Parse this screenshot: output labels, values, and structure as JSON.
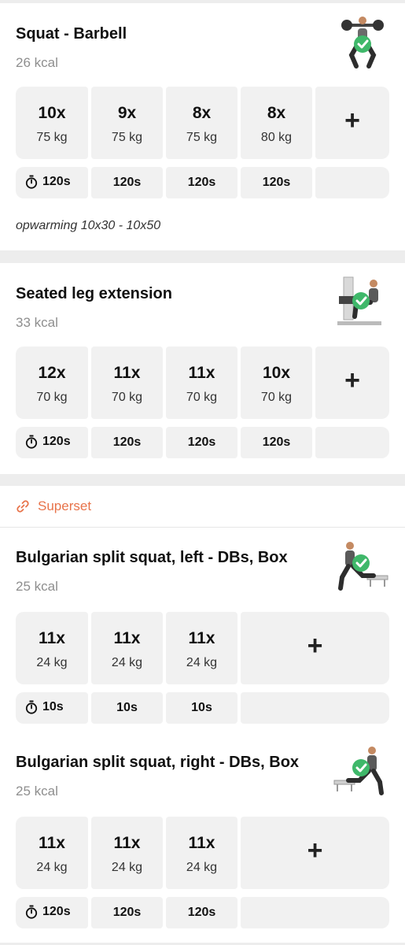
{
  "exercises": [
    {
      "name": "Squat - Barbell",
      "kcal": "26 kcal",
      "sets": [
        {
          "reps": "10x",
          "weight": "75 kg",
          "rest": "120s"
        },
        {
          "reps": "9x",
          "weight": "75 kg",
          "rest": "120s"
        },
        {
          "reps": "8x",
          "weight": "75 kg",
          "rest": "120s"
        },
        {
          "reps": "8x",
          "weight": "80 kg",
          "rest": "120s"
        }
      ],
      "add_label": "+",
      "note": "opwarming 10x30 - 10x50",
      "completed": true
    },
    {
      "name": "Seated leg extension",
      "kcal": "33 kcal",
      "sets": [
        {
          "reps": "12x",
          "weight": "70 kg",
          "rest": "120s"
        },
        {
          "reps": "11x",
          "weight": "70 kg",
          "rest": "120s"
        },
        {
          "reps": "11x",
          "weight": "70 kg",
          "rest": "120s"
        },
        {
          "reps": "10x",
          "weight": "70 kg",
          "rest": "120s"
        }
      ],
      "add_label": "+",
      "completed": true
    }
  ],
  "superset": {
    "label": "Superset",
    "exercises": [
      {
        "name": "Bulgarian split squat, left - DBs, Box",
        "kcal": "25 kcal",
        "sets": [
          {
            "reps": "11x",
            "weight": "24 kg",
            "rest": "10s"
          },
          {
            "reps": "11x",
            "weight": "24 kg",
            "rest": "10s"
          },
          {
            "reps": "11x",
            "weight": "24 kg",
            "rest": "10s"
          }
        ],
        "add_label": "+",
        "completed": true
      },
      {
        "name": "Bulgarian split squat, right - DBs, Box",
        "kcal": "25 kcal",
        "sets": [
          {
            "reps": "11x",
            "weight": "24 kg",
            "rest": "120s"
          },
          {
            "reps": "11x",
            "weight": "24 kg",
            "rest": "120s"
          },
          {
            "reps": "11x",
            "weight": "24 kg",
            "rest": "120s"
          }
        ],
        "add_label": "+",
        "completed": true
      }
    ]
  },
  "icons": {
    "timer": "stopwatch-icon",
    "link": "link-icon",
    "check": "checkmark-badge-icon"
  },
  "colors": {
    "accent": "#e8734a",
    "check_green": "#3fb86a",
    "cell_bg": "#f1f1f1"
  }
}
